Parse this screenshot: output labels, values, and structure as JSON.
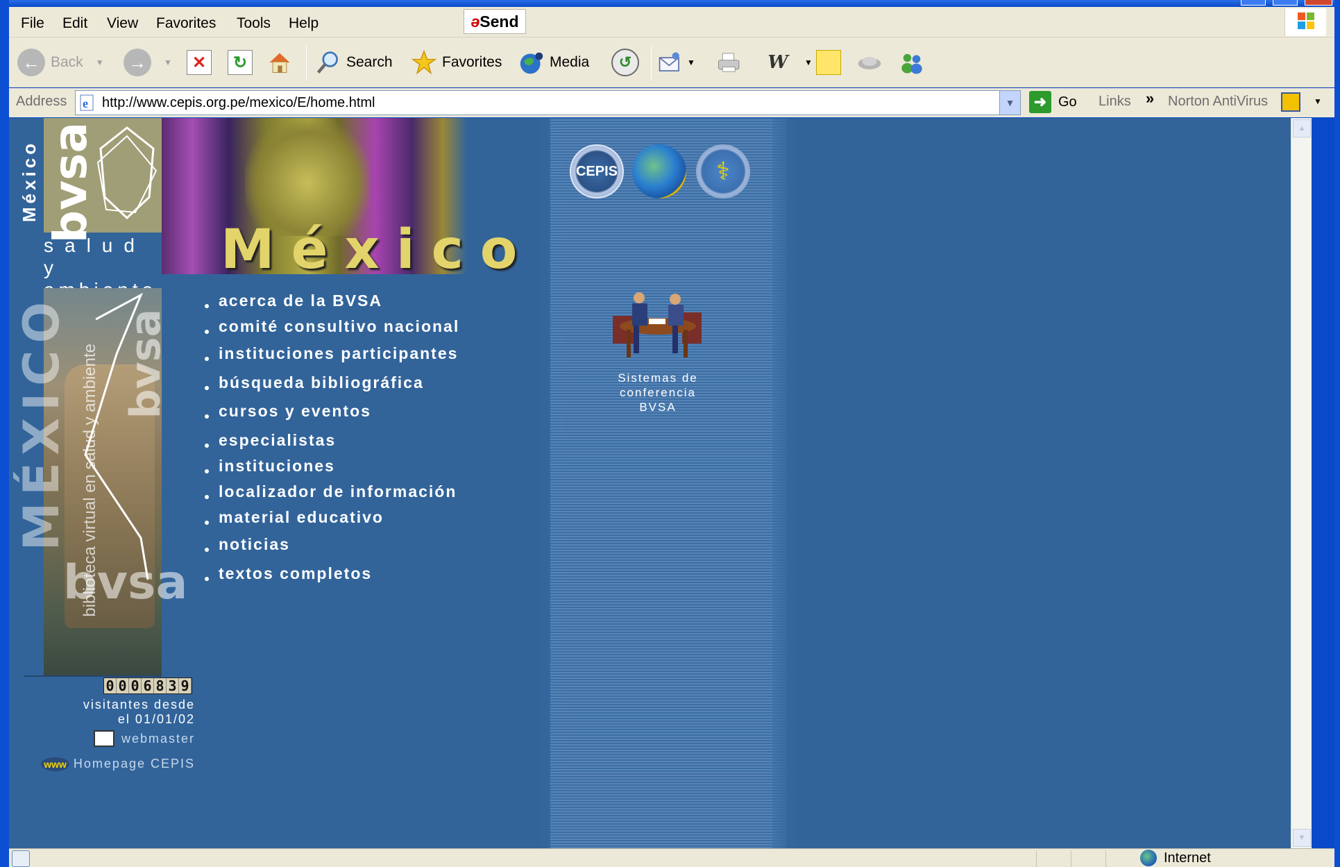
{
  "window": {
    "menu": [
      "File",
      "Edit",
      "View",
      "Favorites",
      "Tools",
      "Help"
    ],
    "send_label": "Send"
  },
  "toolbar": {
    "back": "Back",
    "search": "Search",
    "favorites": "Favorites",
    "media": "Media"
  },
  "address": {
    "label": "Address",
    "url": "http://www.cepis.org.pe/mexico/E/home.html",
    "go": "Go",
    "links": "Links",
    "norton": "Norton AntiVirus"
  },
  "page": {
    "side_mexico": "México",
    "bvsa": "bvsa",
    "salud_line1": "salud y",
    "salud_line2": "ambiente",
    "banner_title": "México",
    "photo_caption": "biblioteca virtual en salud y ambiente",
    "photo_big_mexico": "MÉXICO",
    "counter": "0006839",
    "visitors_line1": "visitantes desde",
    "visitors_line2": "el 01/01/02",
    "webmaster": "webmaster",
    "homepage": "Homepage CEPIS",
    "nav": [
      "acerca de la BVSA",
      "comité consultivo nacional",
      "instituciones participantes",
      "búsqueda bibliográfica",
      "cursos y eventos",
      "especialistas",
      "instituciones",
      "localizador de información",
      "material educativo",
      "noticias",
      "textos completos"
    ],
    "seal_cepis": "CEPIS",
    "conference_line1": "Sistemas de",
    "conference_line2": "conferencia",
    "conference_line3": "BVSA"
  },
  "status": {
    "zone": "Internet"
  },
  "colors": {
    "page_bg": "#32649a",
    "banner_gold": "#e2d46a",
    "chrome": "#ece9d8"
  }
}
